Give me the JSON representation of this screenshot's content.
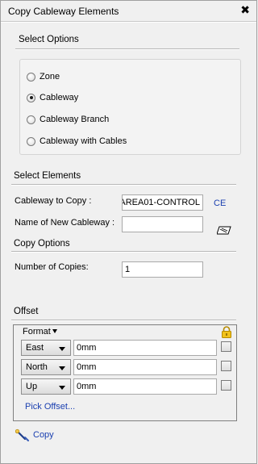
{
  "title": "Copy Cableway Elements",
  "close_glyph": "✖",
  "select_options": {
    "heading": "Select Options",
    "options": [
      {
        "label": "Zone",
        "checked": false
      },
      {
        "label": "Cableway",
        "checked": true
      },
      {
        "label": "Cableway Branch",
        "checked": false
      },
      {
        "label": "Cableway with Cables",
        "checked": false
      }
    ]
  },
  "select_elements": {
    "heading": "Select Elements",
    "cableway_to_copy_label": "Cableway to Copy :",
    "cableway_to_copy_value": "AREA01-CONTROL",
    "ce_link": "CE",
    "new_name_label": "Name of New Cableway :",
    "new_name_value": "",
    "pick_icon": "pick-element-icon"
  },
  "copy_options": {
    "heading": "Copy Options",
    "num_copies_label": "Number of Copies:",
    "num_copies_value": "1"
  },
  "offset": {
    "heading": "Offset",
    "format_label": "Format",
    "lock_icon": "lock-icon",
    "rows": [
      {
        "direction": "East",
        "value": "0mm",
        "checked": false
      },
      {
        "direction": "North",
        "value": "0mm",
        "checked": false
      },
      {
        "direction": "Up",
        "value": "0mm",
        "checked": false
      }
    ],
    "pick_offset": "Pick Offset..."
  },
  "copy_button": {
    "label": "Copy",
    "icon": "copy-wand-icon"
  }
}
